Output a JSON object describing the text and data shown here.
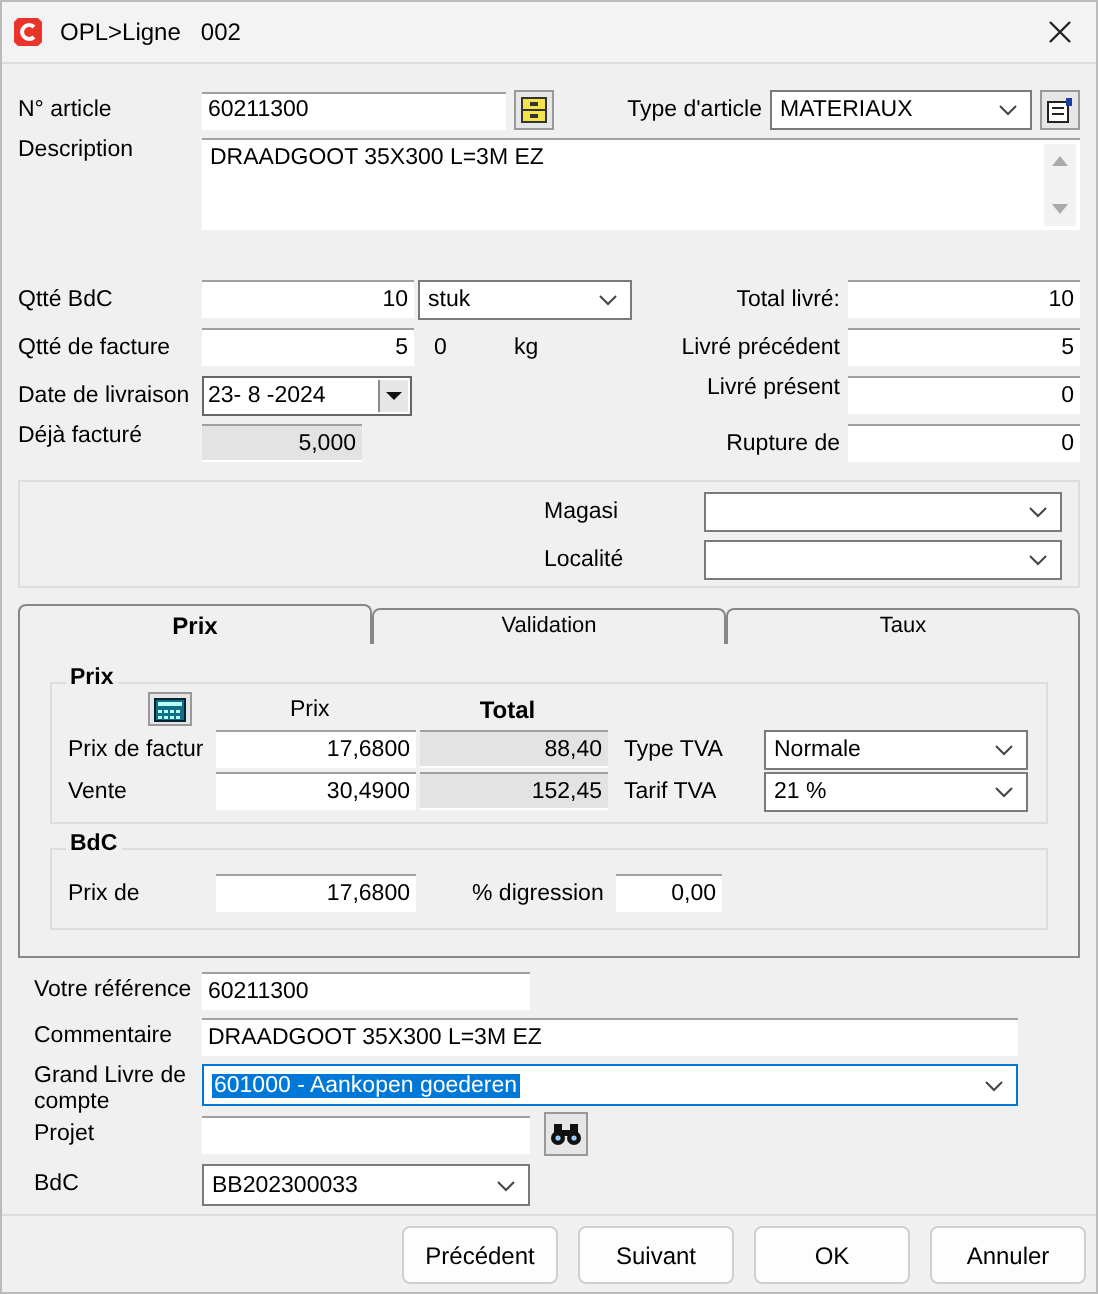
{
  "window": {
    "title": "OPL>Ligne",
    "number": "002"
  },
  "article": {
    "label": "N° article",
    "value": "60211300",
    "type_label": "Type d'article",
    "type_value": "MATERIAUX"
  },
  "description": {
    "label": "Description",
    "value": "DRAADGOOT 35X300 L=3M EZ"
  },
  "qty_bdc": {
    "label": "Qtté BdC",
    "value": "10",
    "unit": "stuk"
  },
  "qty_invoice": {
    "label": "Qtté de facture",
    "value": "5",
    "weight": "0",
    "weight_unit": "kg"
  },
  "delivery_date": {
    "label": "Date de livraison",
    "value": "23- 8 -2024"
  },
  "invoiced": {
    "label": "Déjà facturé",
    "value": "5,000"
  },
  "right_fields": [
    {
      "label": "Total livré:",
      "value": "10"
    },
    {
      "label": "Livré précédent",
      "value": "5"
    },
    {
      "label": "Livré présent",
      "value": "0"
    },
    {
      "label": "Rupture de",
      "value": "0"
    }
  ],
  "storage": [
    {
      "label": "Magasi"
    },
    {
      "label": "Localité"
    }
  ],
  "tabs": [
    {
      "label": "Prix",
      "selected": true
    },
    {
      "label": "Validation",
      "selected": false
    },
    {
      "label": "Taux",
      "selected": false
    }
  ],
  "prix_group": {
    "title": "Prix",
    "col_price": "Prix",
    "col_total": "Total",
    "rows": [
      {
        "label": "Prix de factur",
        "price": "17,6800",
        "total": "88,40"
      },
      {
        "label": "Vente",
        "price": "30,4900",
        "total": "152,45"
      }
    ],
    "vat": [
      {
        "label": "Type TVA",
        "value": "Normale"
      },
      {
        "label": "Tarif TVA",
        "value": "21 %"
      }
    ]
  },
  "bdc_group": {
    "title": "BdC",
    "price_label": "Prix de",
    "price": "17,6800",
    "discount_label": "% digression",
    "discount": "0,00"
  },
  "bottom_fields": [
    {
      "kind": "input",
      "label": "Votre référence",
      "value": "60211300",
      "focused": false
    },
    {
      "kind": "input",
      "label": "Commentaire",
      "value": "DRAADGOOT 35X300 L=3M EZ",
      "focused": false
    },
    {
      "kind": "select",
      "label": "Grand Livre de compte",
      "value": "601000 - Aankopen goederen",
      "focused": true
    },
    {
      "kind": "search",
      "label": "Projet",
      "focused": false
    },
    {
      "kind": "select",
      "label": "BdC",
      "value": "BB202300033",
      "focused": false
    }
  ],
  "buttons": [
    "Précédent",
    "Suivant",
    "OK",
    "Annuler"
  ]
}
